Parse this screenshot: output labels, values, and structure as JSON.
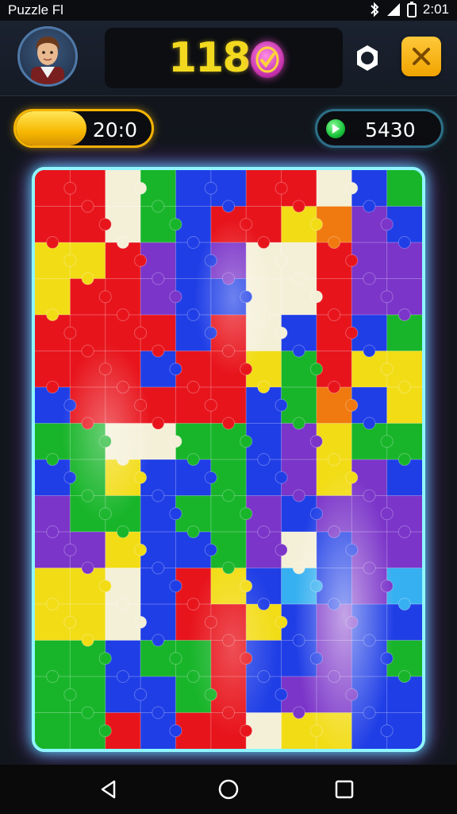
{
  "status_bar": {
    "app_title": "Puzzle Fl",
    "time": "2:01"
  },
  "header": {
    "score": "118",
    "avatar_icon": "player-portrait",
    "settings_icon": "settings-ring-icon",
    "close_icon": "close-x-icon"
  },
  "progress": {
    "label": "20:0",
    "fill_fraction": 0.52,
    "color": "#f7b800"
  },
  "gems": {
    "label": "5430",
    "icon": "green-gem-icon"
  },
  "board": {
    "columns": 11,
    "rows": 16,
    "palette": {
      "R": "#e8141c",
      "G": "#18b52a",
      "B": "#1f3ee6",
      "P": "#7b35c9",
      "Y": "#f2dc16",
      "W": "#f4f0d8",
      "O": "#f07a10",
      "C": "#36b0f0"
    },
    "grid": [
      "RRWGBBRRWBG",
      "RRWGBRRYOPB",
      "YYRPBPWWRPP",
      "YRRPBBWWRPP",
      "RRRRBRWBRBG",
      "RRRBRRYGRYY",
      "BRRRRRBGOBY",
      "GGWWGGBPYGG",
      "BGYBBGBPYPB",
      "PGGBGGPBPPP",
      "PPYBBGPWBPP",
      "YYWBRYBCBPC",
      "YYWBRRYBPBB",
      "GGBGGRBBPBG",
      "GGBBGRBPPBB",
      "GGRBRRWYYBB"
    ]
  },
  "nav": {
    "back_icon": "back-triangle-icon",
    "home_icon": "home-circle-icon",
    "recents_icon": "recents-square-icon"
  }
}
